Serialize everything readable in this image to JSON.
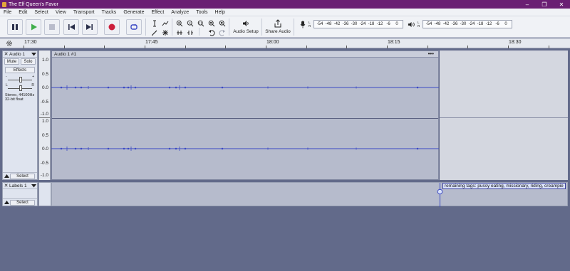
{
  "window": {
    "title": "The Elf Queen's Favor",
    "controls": [
      "–",
      "❐",
      "✕"
    ]
  },
  "menu": [
    "File",
    "Edit",
    "Select",
    "View",
    "Transport",
    "Tracks",
    "Generate",
    "Effect",
    "Analyze",
    "Tools",
    "Help"
  ],
  "toolbar": {
    "audio_setup_label": "Audio Setup",
    "share_audio_label": "Share Audio",
    "record_meter": {
      "channels": [
        "L",
        "R"
      ],
      "scale": [
        "-54",
        "-48",
        "-42",
        "-36",
        "-30",
        "-24",
        "-18",
        "-12",
        "-6",
        "0"
      ]
    },
    "playback_meter": {
      "channels": [
        "L",
        "R"
      ],
      "scale": [
        "-54",
        "-48",
        "-42",
        "-36",
        "-30",
        "-24",
        "-18",
        "-12",
        "-6",
        "0"
      ]
    },
    "colors": {
      "record": "#cc1f3c",
      "play": "#3fae4a",
      "accent": "#3b49c4"
    }
  },
  "ruler": {
    "labels": [
      "17:30",
      "17:45",
      "18:00",
      "18:15",
      "18:30"
    ]
  },
  "audio_track": {
    "name": "Audio 1",
    "mute_label": "Mute",
    "solo_label": "Solo",
    "effects_label": "Effects",
    "gain_minus": "-",
    "gain_plus": "+",
    "pan_left": "L",
    "pan_right": "R",
    "info_line1": "Stereo, 44100Hz",
    "info_line2": "32-bit float",
    "select_label": "Select",
    "clip_name": "Audio 1 #1",
    "clip_menu": "•••",
    "scale_top": [
      "1.0",
      "0.5",
      "0.0",
      "-0.5",
      "-1.0"
    ],
    "scale_bottom": [
      "1.0",
      "0.5",
      "0.0",
      "-0.5",
      "-1.0"
    ]
  },
  "label_track": {
    "name": "Labels 1",
    "select_label": "Select",
    "label_text": "remaining tags: pussy eating, missionary, riding, creampie"
  }
}
